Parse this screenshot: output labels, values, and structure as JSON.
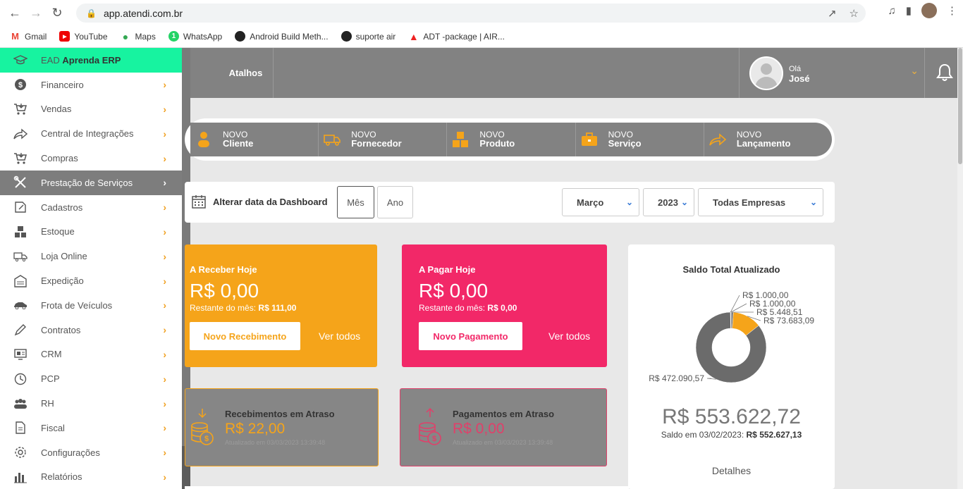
{
  "browser": {
    "url": "app.atendi.com.br",
    "bookmarks": [
      "Gmail",
      "YouTube",
      "Maps",
      "WhatsApp",
      "Android Build Meth...",
      "suporte air",
      "ADT -package | AIR..."
    ]
  },
  "header": {
    "shortcuts_label": "Atalhos",
    "greeting": "Olá",
    "user_name": "José"
  },
  "sidebar": {
    "ead_prefix": "EAD",
    "ead_bold": "Aprenda ERP",
    "items": [
      {
        "label": "Financeiro",
        "icon": "dollar-icon"
      },
      {
        "label": "Vendas",
        "icon": "cart-icon"
      },
      {
        "label": "Central de Integrações",
        "icon": "share-icon"
      },
      {
        "label": "Compras",
        "icon": "cart-icon"
      },
      {
        "label": "Prestação de Serviços",
        "icon": "tools-icon"
      },
      {
        "label": "Cadastros",
        "icon": "edit-icon"
      },
      {
        "label": "Estoque",
        "icon": "boxes-icon"
      },
      {
        "label": "Loja Online",
        "icon": "truck-icon"
      },
      {
        "label": "Expedição",
        "icon": "warehouse-icon"
      },
      {
        "label": "Frota de Veículos",
        "icon": "car-icon"
      },
      {
        "label": "Contratos",
        "icon": "pen-icon"
      },
      {
        "label": "CRM",
        "icon": "crm-icon"
      },
      {
        "label": "PCP",
        "icon": "clock-icon"
      },
      {
        "label": "RH",
        "icon": "people-icon"
      },
      {
        "label": "Fiscal",
        "icon": "document-icon"
      },
      {
        "label": "Configurações",
        "icon": "gear-icon"
      },
      {
        "label": "Relatórios",
        "icon": "bar-chart-icon"
      }
    ]
  },
  "quick": [
    {
      "top": "NOVO",
      "bottom": "Cliente"
    },
    {
      "top": "NOVO",
      "bottom": "Fornecedor"
    },
    {
      "top": "NOVO",
      "bottom": "Produto"
    },
    {
      "top": "NOVO",
      "bottom": "Serviço"
    },
    {
      "top": "NOVO",
      "bottom": "Lançamento"
    }
  ],
  "datebar": {
    "label": "Alterar data da Dashboard",
    "month_btn": "Mês",
    "year_btn": "Ano",
    "month_value": "Março",
    "year_value": "2023",
    "company_value": "Todas Empresas"
  },
  "receber": {
    "title": "A Receber Hoje",
    "amount": "R$ 0,00",
    "rest_label": "Restante do mês:",
    "rest_value": "R$ 111,00",
    "button": "Novo Recebimento",
    "see_all": "Ver todos"
  },
  "pagar": {
    "title": "A Pagar Hoje",
    "amount": "R$ 0,00",
    "rest_label": "Restante do mês:",
    "rest_value": "R$ 0,00",
    "button": "Novo Pagamento",
    "see_all": "Ver todos"
  },
  "late_receb": {
    "title": "Recebimentos em Atraso",
    "amount": "R$ 22,00",
    "updated": "Atualizado em 03/03/2023 13:39:48"
  },
  "late_pag": {
    "title": "Pagamentos em Atraso",
    "amount": "R$ 0,00",
    "updated": "Atualizado em 03/03/2023 13:39:48"
  },
  "saldo": {
    "title": "Saldo Total Atualizado",
    "amount": "R$ 553.622,72",
    "em_label": "Saldo em 03/02/2023:",
    "em_value": "R$ 552.627,13",
    "details": "Detalhes"
  },
  "chart_data": {
    "type": "pie",
    "title": "Saldo Total Atualizado",
    "labels": [
      "R$ 1.000,00",
      "R$ 1.000,00",
      "R$ 5.448,51",
      "R$ 73.683,09",
      "R$ 472.090,57"
    ],
    "values": [
      1000.0,
      1000.0,
      5448.51,
      73683.09,
      472090.57
    ],
    "colors": [
      "#5a5a5a",
      "#9a9a9a",
      "#6e6e6e",
      "#f5a41a",
      "#6b6b6b"
    ]
  },
  "colors": {
    "accent_orange": "#f5a41a",
    "accent_pink": "#f22868",
    "ead_green": "#17f3a0",
    "header_gray": "#828282"
  }
}
